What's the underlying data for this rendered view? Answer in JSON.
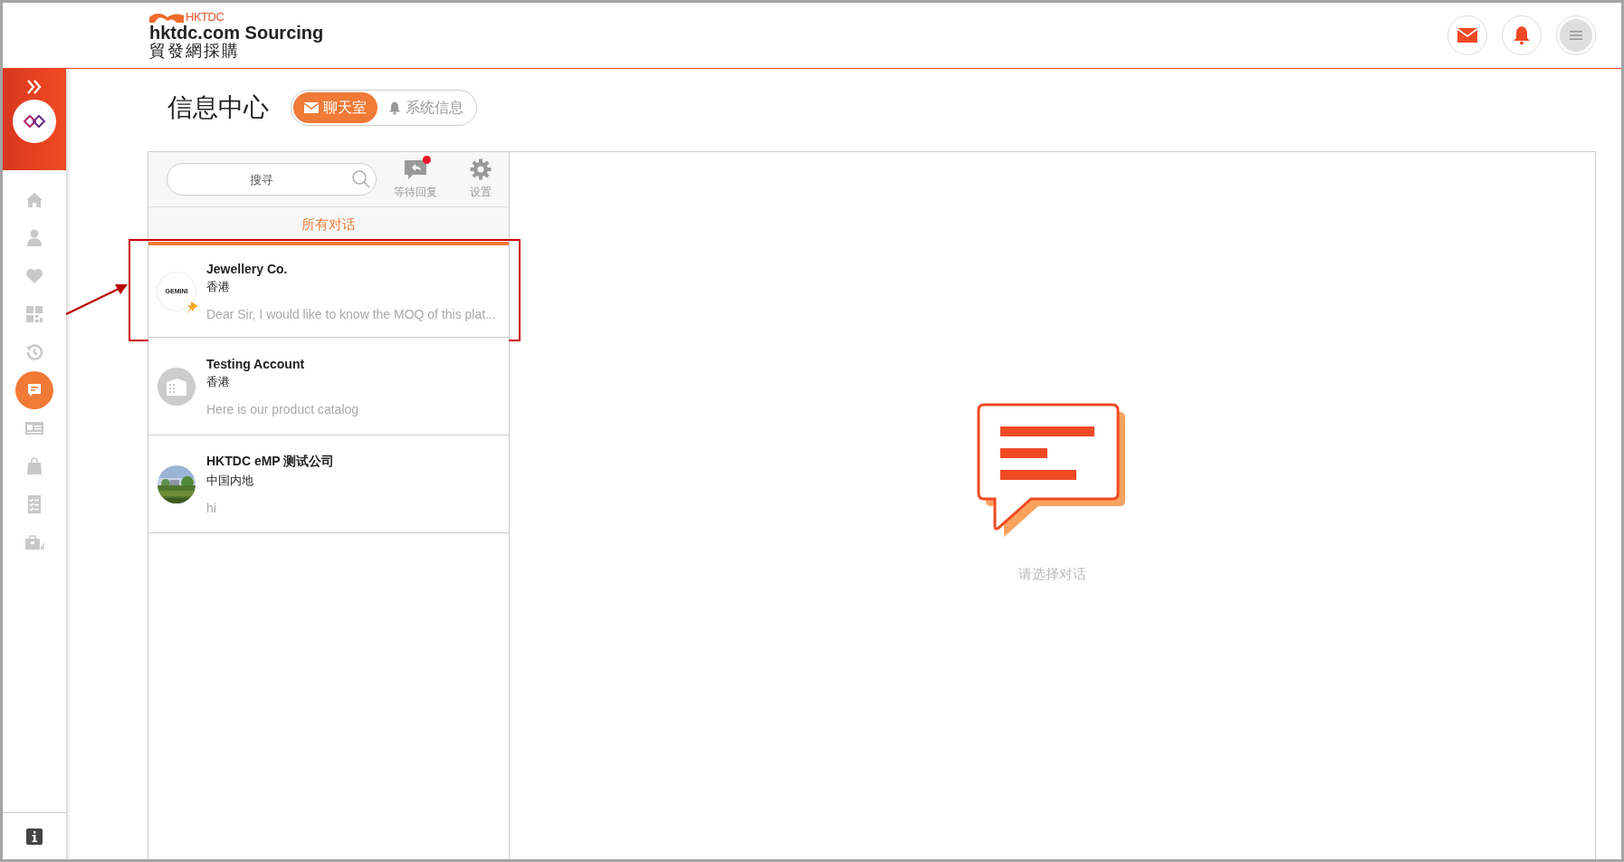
{
  "header": {
    "brand": "HKTDC",
    "title": "hktdc.com Sourcing",
    "subtitle": "貿發網採購"
  },
  "sidebar": {
    "items": [
      {
        "selected": false
      },
      {
        "selected": false
      },
      {
        "selected": false
      },
      {
        "selected": false
      },
      {
        "selected": false
      },
      {
        "selected": true
      },
      {
        "selected": false
      },
      {
        "selected": false
      },
      {
        "selected": false
      },
      {
        "selected": false
      }
    ]
  },
  "page_title": "信息中心",
  "mode_tabs": [
    {
      "label": "聊天室",
      "selected": true
    },
    {
      "label": "系统信息",
      "selected": false
    }
  ],
  "toolbar": {
    "search": {
      "placeholder": "搜寻"
    },
    "actions": [
      {
        "label": "等待回复",
        "unread": true
      },
      {
        "label": "设置",
        "unread": false
      }
    ]
  },
  "list_tabs": [
    {
      "label": "所有对话",
      "selected": true
    }
  ],
  "conversations": [
    {
      "name": "Jewellery Co.",
      "region": "香港",
      "preview": "Dear Sir, I would like to know the MOQ of this plat...",
      "avatar": {
        "kind": "logo",
        "text": "GEMINI"
      },
      "pinned": true,
      "highlighted": true
    },
    {
      "name": "Testing Account",
      "region": "香港",
      "preview": "Here is our product catalog",
      "avatar": {
        "kind": "building"
      },
      "pinned": false,
      "highlighted": false
    },
    {
      "name": "HKTDC eMP 测试公司",
      "region": "中国内地",
      "preview": "hi",
      "pinned": false,
      "highlighted": false
    }
  ],
  "empty_state": {
    "message": "请选择对话"
  }
}
